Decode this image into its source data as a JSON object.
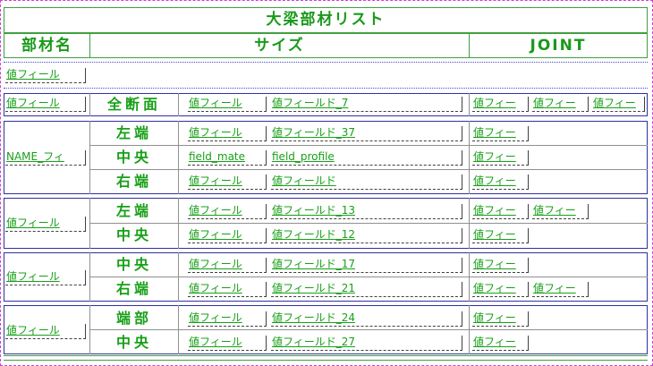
{
  "title": "大梁部材リスト",
  "headers": {
    "member_name": "部材名",
    "size": "サイズ",
    "joint": "JOINT"
  },
  "placeholder_full": "値フィールド",
  "placeholder_short": "値フィー",
  "section_header_field": "値フィール",
  "row_full": {
    "position": "全断面",
    "name": "値フィール",
    "mat": "値フィール",
    "profile": "値フィールド_7",
    "joints": [
      "値フィー",
      "値フィー",
      "値フィー"
    ]
  },
  "groups": [
    {
      "name": "NAME_フィ",
      "rows": [
        {
          "position": "左端",
          "mat": "値フィール",
          "profile": "値フィールド_37",
          "joints": [
            "値フィー"
          ]
        },
        {
          "position": "中央",
          "mat": "field_mate",
          "profile": "field_profile",
          "joints": [
            "値フィー"
          ]
        },
        {
          "position": "右端",
          "mat": "値フィール",
          "profile": "値フィールド",
          "joints": [
            "値フィー"
          ]
        }
      ]
    },
    {
      "name": "値フィール",
      "rows": [
        {
          "position": "左端",
          "mat": "値フィール",
          "profile": "値フィールド_13",
          "joints": [
            "値フィー",
            "値フィー"
          ]
        },
        {
          "position": "中央",
          "mat": "値フィール",
          "profile": "値フィールド_12",
          "joints": [
            "値フィー"
          ]
        }
      ]
    },
    {
      "name": "値フィール",
      "rows": [
        {
          "position": "中央",
          "mat": "値フィール",
          "profile": "値フィールド_17",
          "joints": [
            "値フィー"
          ]
        },
        {
          "position": "右端",
          "mat": "値フィール",
          "profile": "値フィールド_21",
          "joints": [
            "値フィー",
            "値フィー"
          ]
        }
      ]
    },
    {
      "name": "値フィール",
      "rows": [
        {
          "position": "端部",
          "mat": "値フィール",
          "profile": "値フィールド_24",
          "joints": [
            "値フィー"
          ]
        },
        {
          "position": "中央",
          "mat": "値フィール",
          "profile": "値フィールド_27",
          "joints": [
            "値フィー"
          ]
        }
      ]
    }
  ]
}
